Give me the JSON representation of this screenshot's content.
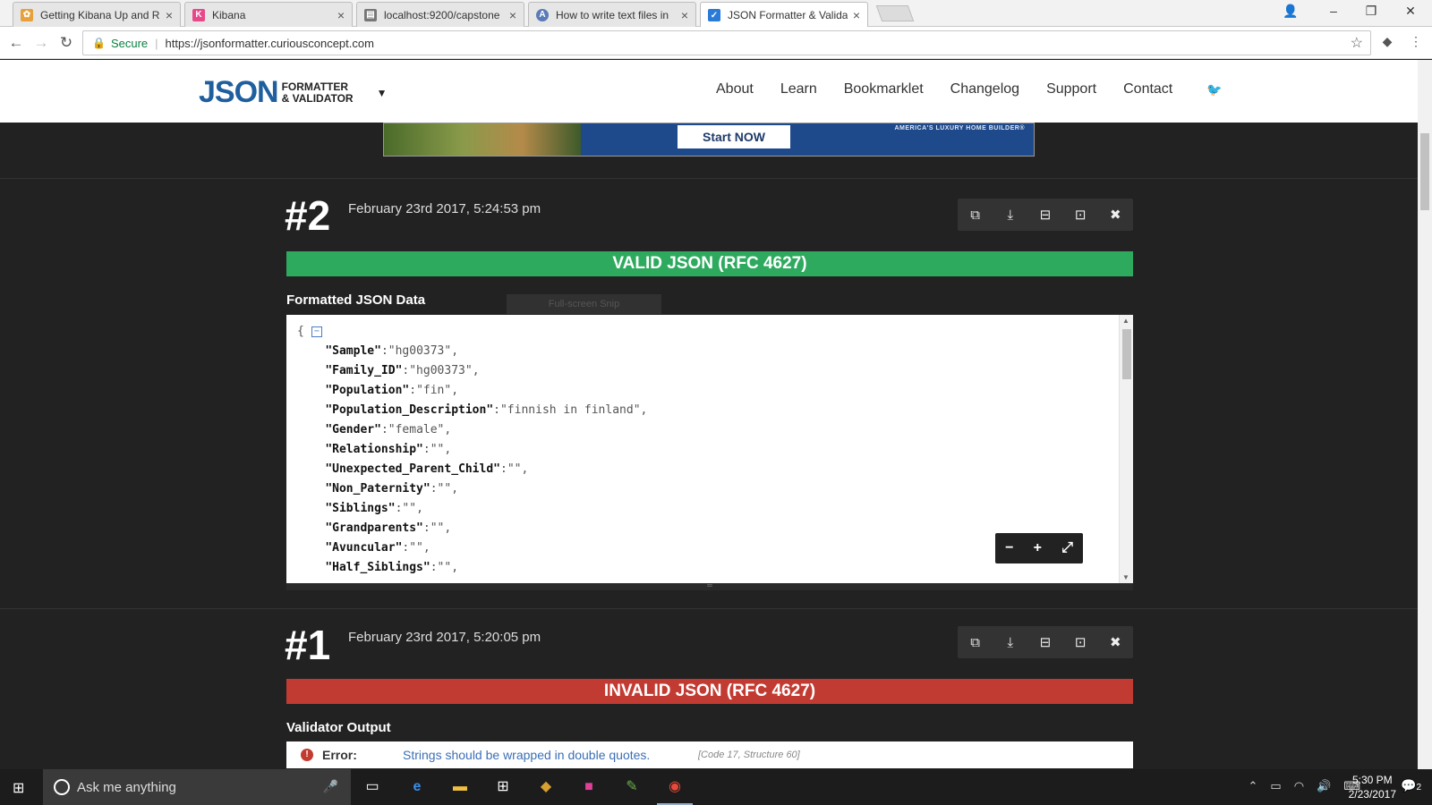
{
  "browser": {
    "tabs": [
      {
        "title": "Getting Kibana Up and R",
        "favicon_color": "#e8a03a"
      },
      {
        "title": "Kibana",
        "favicon_color": "#e8488a"
      },
      {
        "title": "localhost:9200/capstone",
        "favicon_color": "#777777"
      },
      {
        "title": "How to write text files in",
        "favicon_color": "#5a7ab8"
      },
      {
        "title": "JSON Formatter & Valida",
        "favicon_color": "#2a7ad8"
      }
    ],
    "secure_label": "Secure",
    "url": "https://jsonformatter.curiousconcept.com"
  },
  "site": {
    "logo_big": "JSON",
    "logo_line1": "FORMATTER",
    "logo_line2": "& VALIDATOR",
    "nav": [
      "About",
      "Learn",
      "Bookmarklet",
      "Changelog",
      "Support",
      "Contact"
    ]
  },
  "ad": {
    "cta": "Start NOW",
    "tagline": "AMERICA'S LUXURY HOME BUILDER®"
  },
  "snip_overlay": "Full-screen Snip",
  "entry2": {
    "number": "#2",
    "date": "February 23rd 2017, 5:24:53 pm",
    "status": "VALID JSON (RFC 4627)",
    "section_label": "Formatted JSON Data",
    "json_lines": [
      {
        "key": "\"Sample\"",
        "value": "\"hg00373\""
      },
      {
        "key": "\"Family_ID\"",
        "value": "\"hg00373\""
      },
      {
        "key": "\"Population\"",
        "value": "\"fin\""
      },
      {
        "key": "\"Population_Description\"",
        "value": "\"finnish in finland\""
      },
      {
        "key": "\"Gender\"",
        "value": "\"female\""
      },
      {
        "key": "\"Relationship\"",
        "value": "\"\""
      },
      {
        "key": "\"Unexpected_Parent_Child\"",
        "value": "\"\""
      },
      {
        "key": "\"Non_Paternity\"",
        "value": "\"\""
      },
      {
        "key": "\"Siblings\"",
        "value": "\"\""
      },
      {
        "key": "\"Grandparents\"",
        "value": "\"\""
      },
      {
        "key": "\"Avuncular\"",
        "value": "\"\""
      },
      {
        "key": "\"Half_Siblings\"",
        "value": "\"\""
      }
    ]
  },
  "entry1": {
    "number": "#1",
    "date": "February 23rd 2017, 5:20:05 pm",
    "status": "INVALID JSON (RFC 4627)",
    "section_label": "Validator Output",
    "error_label": "Error:",
    "error_message": "Strings should be wrapped in double quotes.",
    "error_code": "[Code 17, Structure 60]"
  },
  "taskbar": {
    "search_placeholder": "Ask me anything",
    "time": "5:30 PM",
    "date": "2/23/2017",
    "notification_count": "2"
  }
}
